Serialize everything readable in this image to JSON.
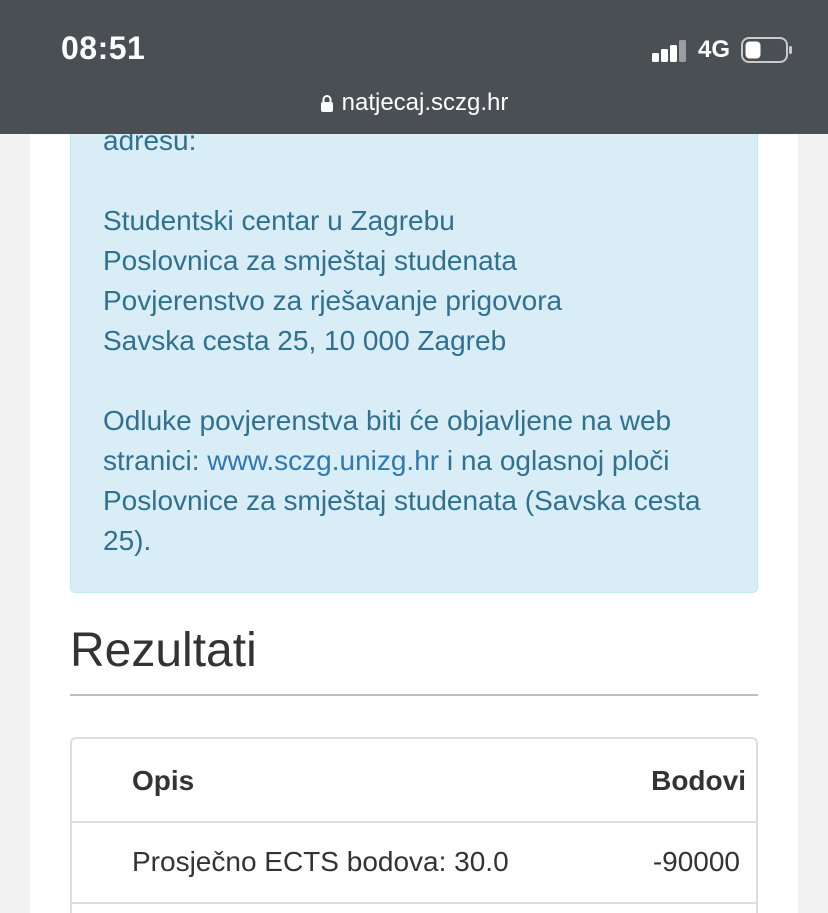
{
  "status_bar": {
    "time": "08:51",
    "network": "4G",
    "url": "natjecaj.sczg.hr"
  },
  "info_box": {
    "line_address_tail": "adresu:",
    "addr_1": "Studentski centar u Zagrebu",
    "addr_2": "Poslovnica za smještaj studenata",
    "addr_3": "Povjerenstvo za rješavanje prigovora",
    "addr_4": "Savska cesta 25, 10 000 Zagreb",
    "decision_1": "Odluke povjerenstva biti će objavljene na web",
    "decision_2_pre": "stranici: ",
    "decision_2_link": "www.sczg.unizg.hr",
    "decision_2_post": " i na oglasnoj ploči",
    "decision_3": "Poslovnice za smještaj studenata (Savska cesta",
    "decision_4": "25)."
  },
  "results": {
    "heading": "Rezultati",
    "columns": {
      "description": "Opis",
      "points": "Bodovi"
    },
    "rows": [
      {
        "description": "Prosječno ECTS bodova: 30.0",
        "points": "-90000"
      }
    ]
  },
  "colors": {
    "status_bar_bg": "#4a4f54",
    "info_bg": "#d9edf7",
    "info_text": "#31708f",
    "link": "#2f79b3"
  }
}
